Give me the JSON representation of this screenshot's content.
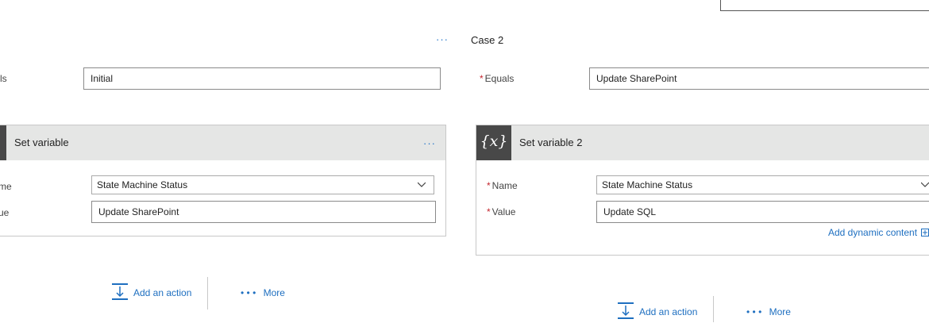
{
  "case2": {
    "title": "Case 2",
    "equals_label": "Equals",
    "equals_value": "Update SharePoint",
    "card": {
      "title": "Set variable 2",
      "icon_text": "{x}",
      "name_label": "Name",
      "name_value": "State Machine Status",
      "value_label": "Value",
      "value_value": "Update SQL",
      "dynamic_link": "Add dynamic content"
    },
    "add_action": "Add an action",
    "more": "More"
  },
  "case1": {
    "equals_label": "ls",
    "equals_value": "Initial",
    "card": {
      "title": "Set variable",
      "name_label": "me",
      "name_value": "State Machine Status",
      "value_label": "ue",
      "value_value": "Update SharePoint"
    },
    "add_action": "Add an action",
    "more": "More"
  },
  "ellipsis": "···",
  "more_dots": "• • •",
  "required_mark": "*"
}
